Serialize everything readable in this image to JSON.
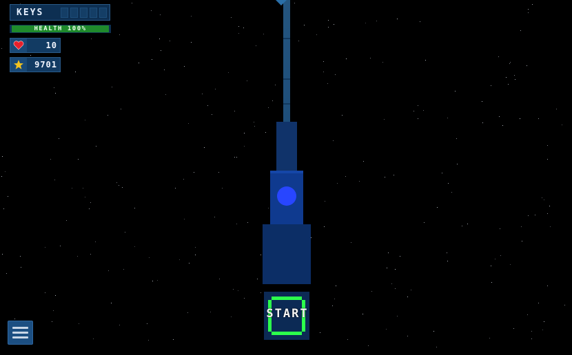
{
  "hud": {
    "keys_label": "KEYS",
    "key_slots_filled": 0,
    "key_slots_total": 5,
    "health_label": "HEALTH 100%",
    "health_percent": 100,
    "lives": "10",
    "score": "9701"
  },
  "game": {
    "start_label": "START"
  },
  "icons": {
    "lives": "heart-icon",
    "score": "star-icon",
    "menu": "hamburger-menu-icon"
  },
  "colors": {
    "background": "#000000",
    "panel": "#0d2f52",
    "health": "#1f8a2c",
    "ball": "#2846ff",
    "start_ring": "#2cff4c"
  }
}
